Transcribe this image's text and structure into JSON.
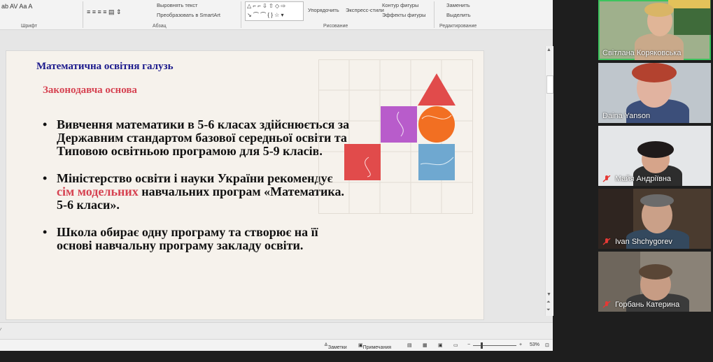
{
  "ribbon": {
    "groups": {
      "font": "Шрифт",
      "paragraph": "Абзац",
      "drawing": "Рисование",
      "editing": "Редактирование"
    },
    "commands": {
      "align_text": "Выровнять текст",
      "convert_smartart": "Преобразовать в SmartArt",
      "arrange": "Упорядочить",
      "quick_styles": "Экспресс-стили",
      "shape_outline": "Контур фигуры",
      "shape_effects": "Эффекты фигуры",
      "replace": "Заменить",
      "select": "Выделить"
    }
  },
  "slide": {
    "heading": "Математична освітня галузь",
    "subheading": "Законодавча основа",
    "bullet1": "Вивчення математики в 5-6 класах здійснюється за Державним стандартом базової середньої освіти та Типовою освітньою програмою для 5-9 класів.",
    "bullet2_part1": "Міністерство освіти і науки України рекомендує ",
    "bullet2_highlight": "сім модельних",
    "bullet2_part2": " навчальних програм «Математика. 5-6 класи».",
    "bullet3": "Школа обирає одну програму та створює на її основі навчальну програму закладу освіти."
  },
  "statusbar": {
    "notes": "Заметки",
    "comments": "Примечания",
    "zoom": "53%"
  },
  "participants": [
    {
      "name": "Світлана Коряковська",
      "muted": false,
      "active": true
    },
    {
      "name": "Daina Yanson",
      "muted": false,
      "active": false
    },
    {
      "name": "Майя Андріївна",
      "muted": true,
      "active": false
    },
    {
      "name": "Ivan Shchygorev",
      "muted": true,
      "active": false
    },
    {
      "name": "Горбань Катерина",
      "muted": true,
      "active": false
    }
  ],
  "colors": {
    "heading": "#1c1a8c",
    "subheading": "#d64251",
    "red": "#e14b4b",
    "purple": "#b85ccb",
    "orange": "#f26f22",
    "blue": "#6fa8d0",
    "active_border": "#3cc45d"
  }
}
